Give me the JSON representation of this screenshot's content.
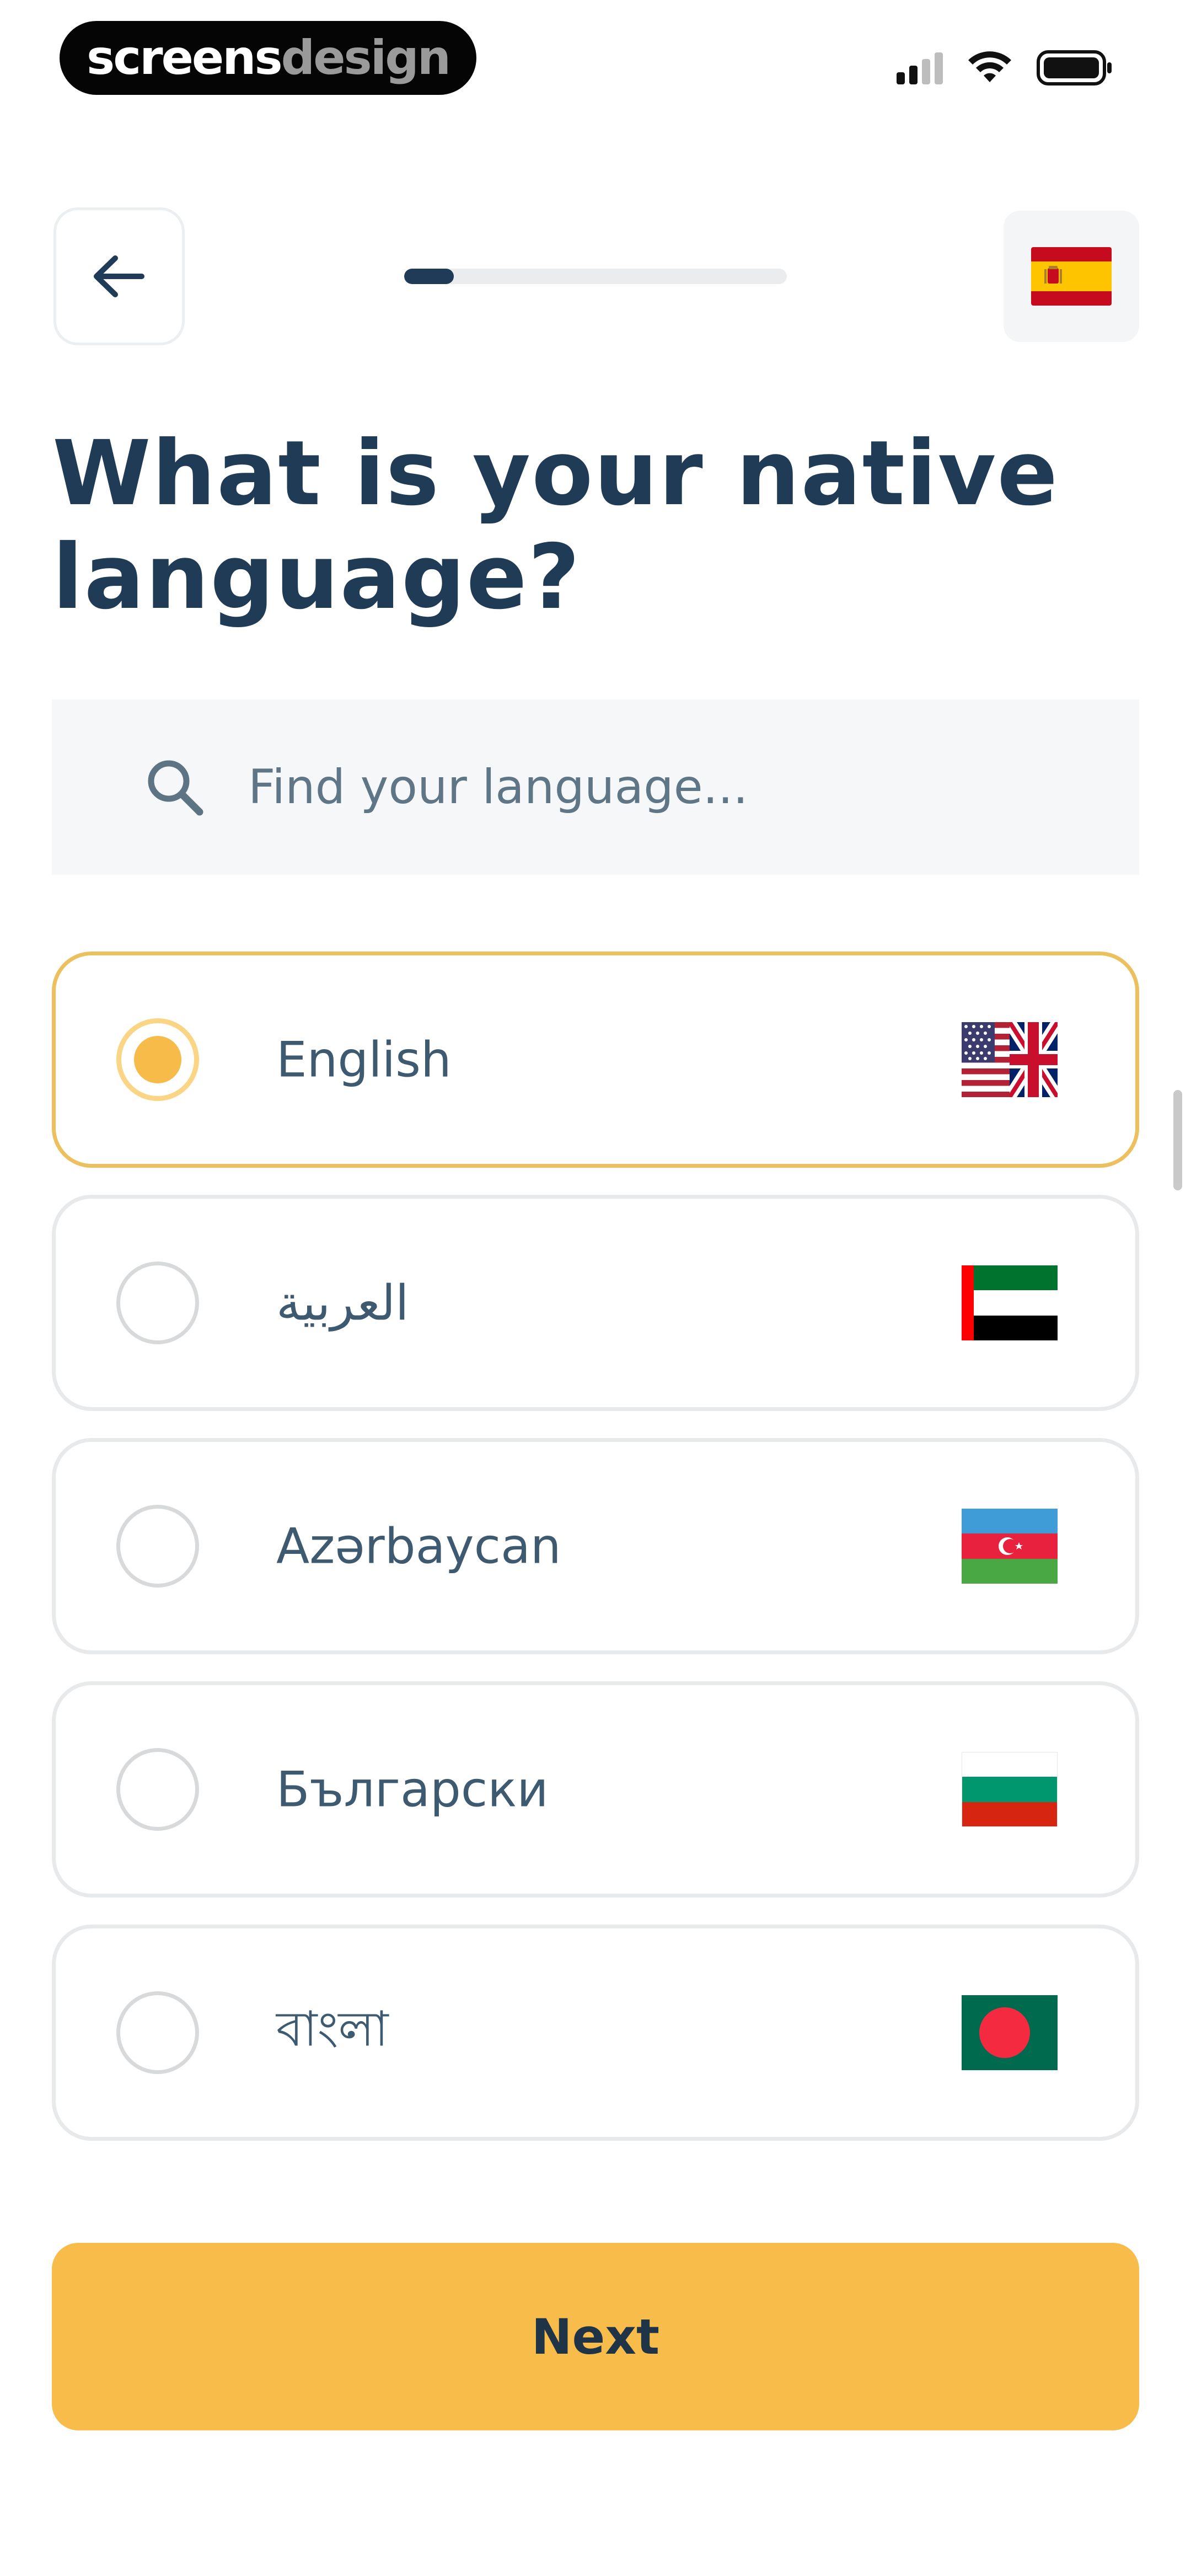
{
  "status_bar": {
    "brand_part1": "screens",
    "brand_part2": "design"
  },
  "header": {
    "progress_fraction": 0.13,
    "selected_flag": "spain-flag-icon"
  },
  "title": "What is your native language?",
  "search": {
    "placeholder": "Find your language..."
  },
  "languages": [
    {
      "label": "English",
      "flag": "us-uk-flag-icon",
      "selected": true
    },
    {
      "label": "العربية",
      "flag": "uae-flag-icon",
      "selected": false
    },
    {
      "label": "Azərbaycan",
      "flag": "azerbaijan-flag-icon",
      "selected": false
    },
    {
      "label": "Български",
      "flag": "bulgaria-flag-icon",
      "selected": false
    },
    {
      "label": "বাংলা",
      "flag": "bangladesh-flag-icon",
      "selected": false
    }
  ],
  "next_button": "Next",
  "colors": {
    "primary_text": "#203b56",
    "accent_yellow": "#f7bc4a",
    "selected_border": "#ecc05e"
  }
}
